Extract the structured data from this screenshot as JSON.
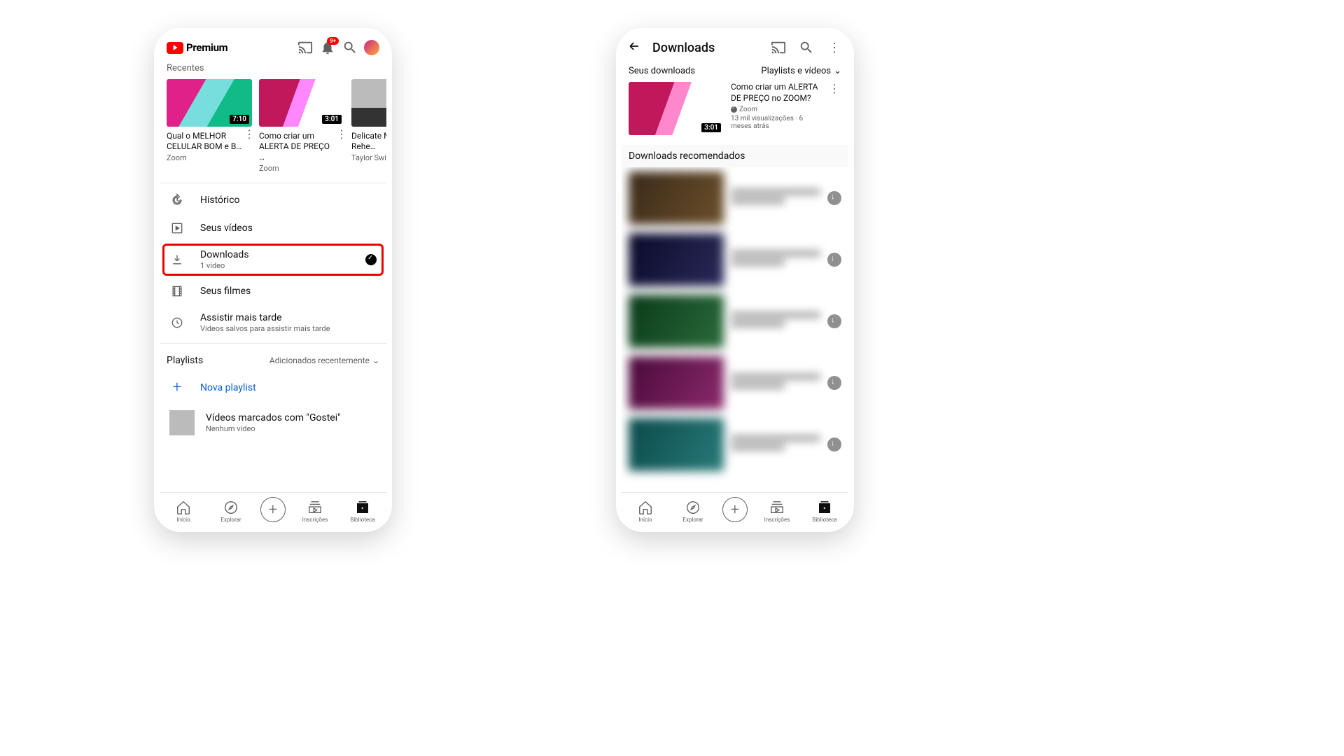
{
  "left": {
    "logo_text": "Premium",
    "notif_badge": "9+",
    "section_recent": "Recentes",
    "videos": [
      {
        "title": "Qual o MELHOR CELULAR BOM e B…",
        "channel": "Zoom",
        "duration": "7:10"
      },
      {
        "title": "Como criar um ALERTA DE PREÇO …",
        "channel": "Zoom",
        "duration": "3:01"
      },
      {
        "title": "Delicate Mu… Dance Rehe…",
        "channel": "Taylor Swift",
        "duration": ""
      }
    ],
    "lib": {
      "history": "Histórico",
      "your_videos": "Seus vídeos",
      "downloads": "Downloads",
      "downloads_sub": "1 vídeo",
      "movies": "Seus filmes",
      "watch_later": "Assistir mais tarde",
      "watch_later_sub": "Vídeos salvos para assistir mais tarde"
    },
    "playlists_header": "Playlists",
    "playlists_sort": "Adicionados recentemente",
    "new_playlist": "Nova playlist",
    "liked_playlist": "Vídeos marcados com \"Gostei\"",
    "liked_sub": "Nenhum vídeo",
    "nav": {
      "home": "Início",
      "explore": "Explorar",
      "subs": "Inscrições",
      "library": "Biblioteca"
    }
  },
  "right": {
    "title": "Downloads",
    "your_dl": "Seus downloads",
    "filter": "Playlists e vídeos",
    "video": {
      "title": "Como criar um ALERTA DE PREÇO no ZOOM?",
      "channel": "Zoom",
      "meta": "13 mil visualizações · 6 meses atrás",
      "duration": "3:01"
    },
    "rec_header": "Downloads recomendados"
  }
}
